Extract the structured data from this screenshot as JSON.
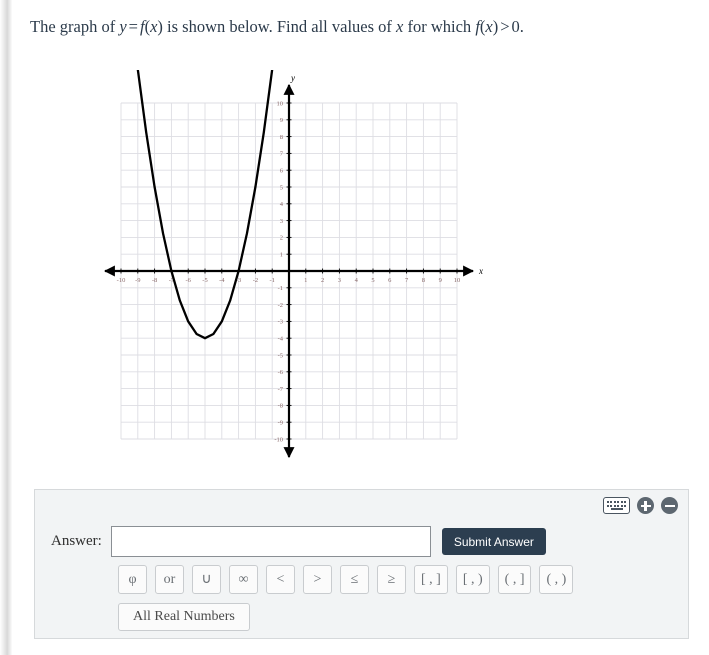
{
  "question": {
    "prefix": "The graph of ",
    "eq_y": "y",
    "eq_equals": "=",
    "eq_f": "f",
    "eq_open": "(",
    "eq_x": "x",
    "eq_close": ")",
    "middle": " is shown below. Find all values of ",
    "var_x": "x",
    "middle2": " for which ",
    "eq2_f": "f",
    "eq2_open": "(",
    "eq2_x": "x",
    "eq2_close": ")",
    "gt": ">",
    "zero": "0."
  },
  "graph": {
    "x_axis_label": "x",
    "y_axis_label": "y",
    "x_ticks": [
      "-10",
      "-9",
      "-8",
      "-7",
      "-6",
      "-5",
      "-4",
      "-3",
      "-2",
      "-1",
      "1",
      "2",
      "3",
      "4",
      "5",
      "6",
      "7",
      "8",
      "9",
      "10"
    ],
    "y_ticks": [
      "10",
      "9",
      "8",
      "7",
      "6",
      "5",
      "4",
      "3",
      "2",
      "1",
      "-1",
      "-2",
      "-3",
      "-4",
      "-5",
      "-6",
      "-7",
      "-8",
      "-9",
      "-10"
    ],
    "grid_color": "#dddde3",
    "axis_color": "#000000",
    "curve_color": "#000000",
    "tick_label_color": "#8a6a6a"
  },
  "chart_data": {
    "type": "line",
    "title": "",
    "xlabel": "x",
    "ylabel": "y",
    "xlim": [
      -10,
      10
    ],
    "ylim": [
      -10,
      10
    ],
    "grid": true,
    "legend": "none",
    "function": "y = (x + 5)^2 - 4",
    "roots": [
      -7,
      -3
    ],
    "vertex": [
      -5,
      -4
    ],
    "series": [
      {
        "name": "f(x)",
        "points": [
          [
            -9.35,
            14.9
          ],
          [
            -9.0,
            12.0
          ],
          [
            -8.5,
            8.25
          ],
          [
            -8.0,
            5.0
          ],
          [
            -7.5,
            2.25
          ],
          [
            -7.0,
            0.0
          ],
          [
            -6.5,
            -1.75
          ],
          [
            -6.0,
            -3.0
          ],
          [
            -5.5,
            -3.75
          ],
          [
            -5.0,
            -4.0
          ],
          [
            -4.5,
            -3.75
          ],
          [
            -4.0,
            -3.0
          ],
          [
            -3.5,
            -1.75
          ],
          [
            -3.0,
            0.0
          ],
          [
            -2.5,
            2.25
          ],
          [
            -2.0,
            5.0
          ],
          [
            -1.5,
            8.25
          ],
          [
            -1.0,
            12.0
          ],
          [
            -0.65,
            14.9
          ]
        ]
      }
    ]
  },
  "answer_panel": {
    "label": "Answer:",
    "input_value": "",
    "input_placeholder": "",
    "submit_label": "Submit Answer",
    "symbols": [
      "φ",
      "or",
      "∪",
      "∞",
      "<",
      ">",
      "≤",
      "≥",
      "[ , ]",
      "[ , )",
      "( , ]",
      "( , )"
    ],
    "all_real_numbers": "All Real Numbers",
    "tools": {
      "keyboard": "keyboard-icon",
      "zoom_in": "plus-circle-icon",
      "zoom_out": "minus-circle-icon"
    },
    "submit_color": "#2c3e50"
  }
}
